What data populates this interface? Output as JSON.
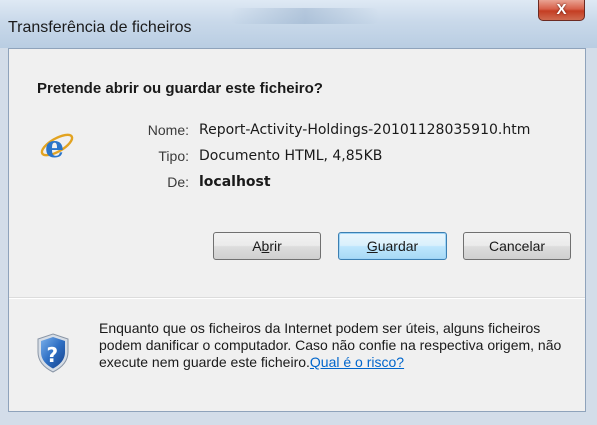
{
  "window": {
    "title": "Transferência de ficheiros",
    "close_label": "X"
  },
  "dialog": {
    "heading": "Pretende abrir ou guardar este ficheiro?",
    "file_icon": "internet-explorer-icon",
    "fields": {
      "name_label": "Nome:",
      "name_value": "Report-Activity-Holdings-20101128035910.htm",
      "type_label": "Tipo:",
      "type_value": "Documento HTML, 4,85KB",
      "from_label": "De:",
      "from_value": "localhost"
    },
    "buttons": {
      "open_pre": "A",
      "open_accel": "b",
      "open_post": "rir",
      "save_pre": "",
      "save_accel": "G",
      "save_post": "uardar",
      "cancel_label": "Cancelar"
    },
    "warning": {
      "icon": "security-shield-help-icon",
      "text": "Enquanto que os ficheiros da Internet podem ser úteis, alguns ficheiros podem danificar o computador. Caso não confie na respectiva origem, não execute nem guarde este ficheiro.",
      "link_text": "Qual é o risco?"
    }
  },
  "colors": {
    "title_bar": "#c9d9ea",
    "close_button": "#c43d22",
    "panel_bg": "#f0f0f0",
    "link": "#0066cc",
    "focused_button_border": "#3c7fb1"
  }
}
